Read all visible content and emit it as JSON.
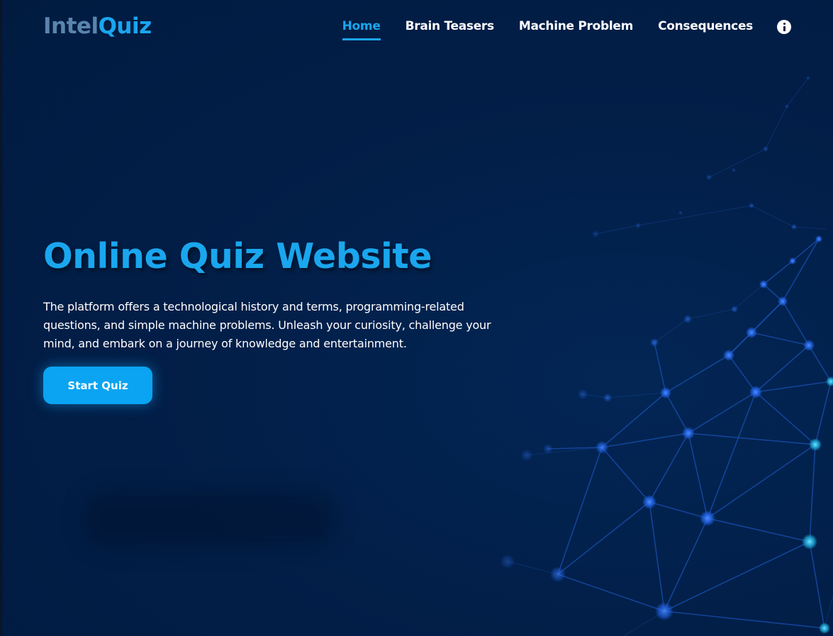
{
  "logo": {
    "part1": "Intel",
    "part2": "Quiz"
  },
  "nav": {
    "items": [
      {
        "label": "Home",
        "active": true
      },
      {
        "label": "Brain Teasers",
        "active": false
      },
      {
        "label": "Machine Problem",
        "active": false
      },
      {
        "label": "Consequences",
        "active": false
      }
    ],
    "info_icon": "info-icon"
  },
  "hero": {
    "title": "Online Quiz Website",
    "description": "The platform offers a technological history and terms, programming-related questions, and simple machine problems. Unleash your curiosity, challenge your mind, and embark on a journey of knowledge and entertainment.",
    "button_label": "Start Quiz"
  },
  "colors": {
    "background": "#011c42",
    "accent": "#1aa6ee",
    "logo_muted": "#5a84ad",
    "text": "#ffffff",
    "network_line": "#1a56c0",
    "network_node": "#1f6bff"
  }
}
